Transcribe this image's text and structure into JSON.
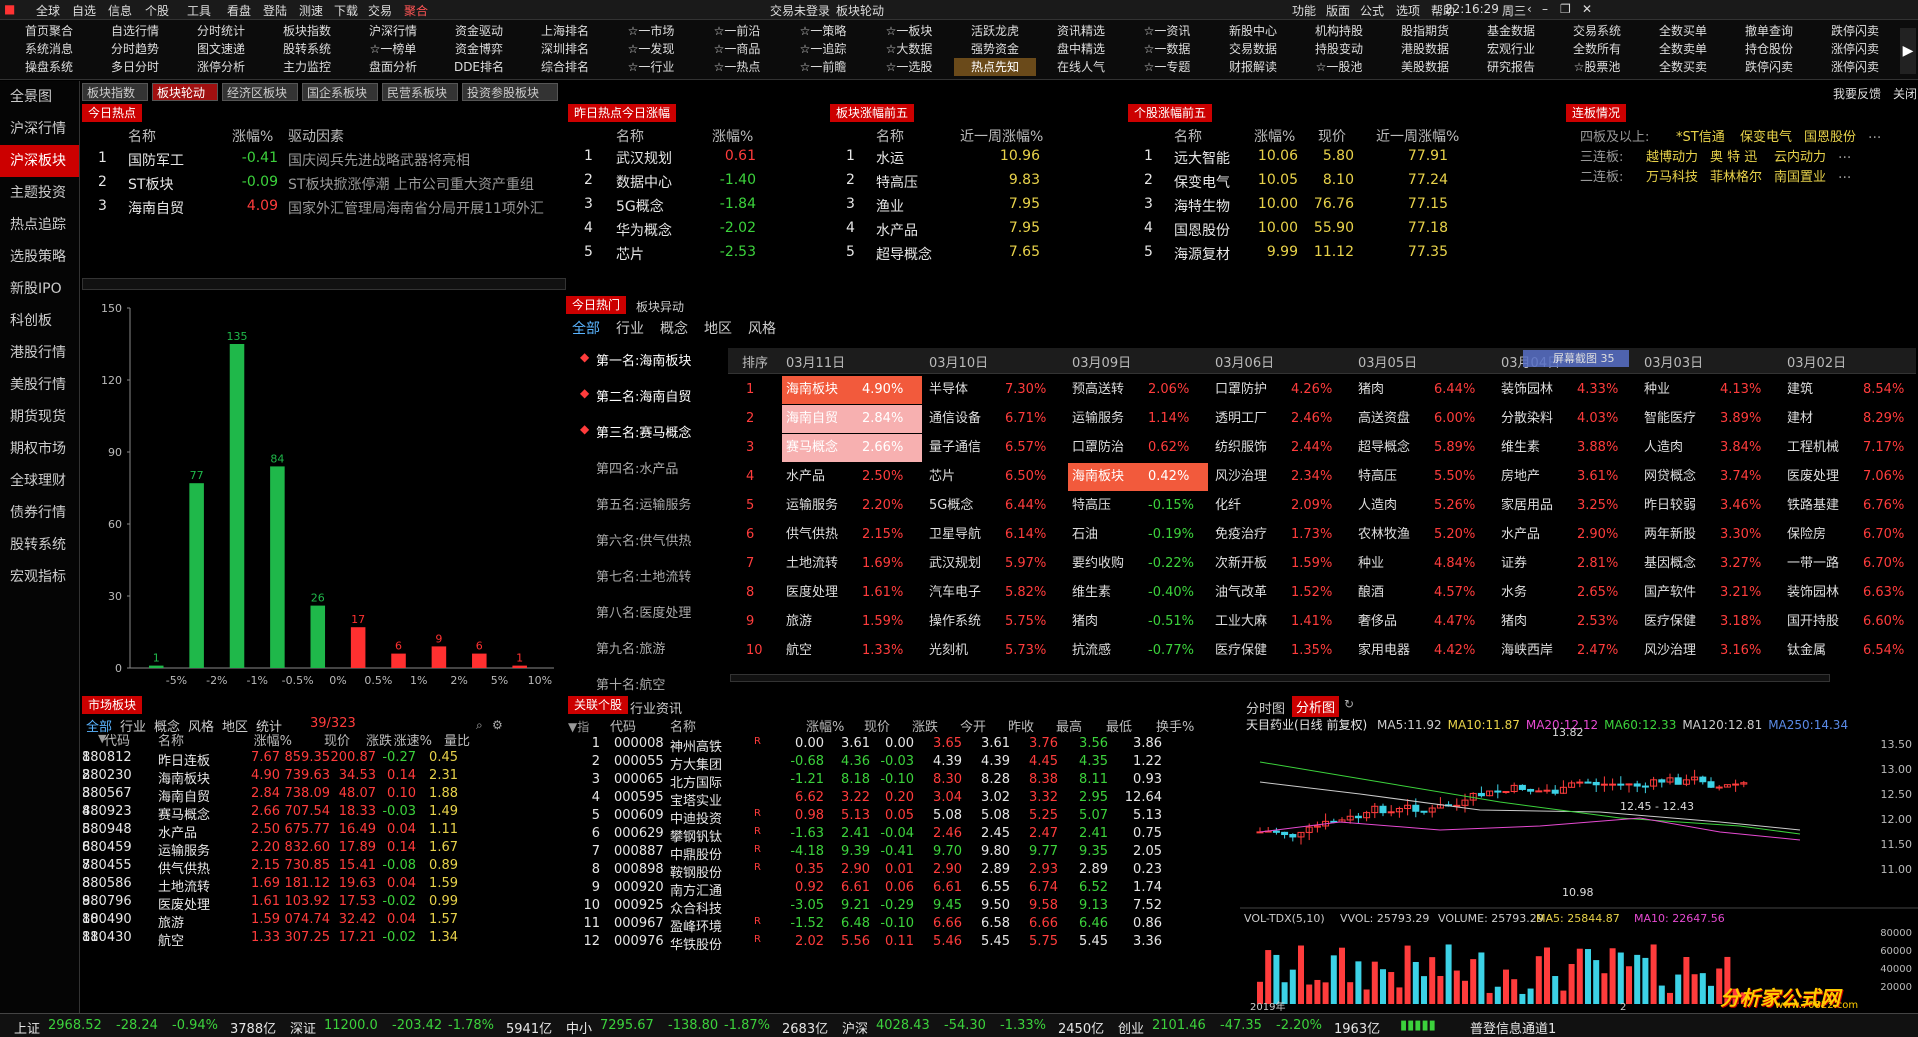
{
  "menu": [
    "全球",
    "自选",
    "信息",
    "个股",
    "工具",
    "看盘",
    "登陆",
    "测速",
    "下载",
    "交易",
    "聚合"
  ],
  "menu_status": [
    "交易未登录",
    "板块轮动"
  ],
  "menu_right": [
    "功能",
    "版面",
    "公式",
    "选项",
    "帮助"
  ],
  "clock": "22:16:29",
  "weekday": "周三",
  "toolbar": [
    [
      "首页聚合",
      "系统消息",
      "操盘系统"
    ],
    [
      "自选行情",
      "分时趋势",
      "多日分时"
    ],
    [
      "分时统计",
      "图文速递",
      "涨停分析"
    ],
    [
      "板块指数",
      "股转系统",
      "主力监控"
    ],
    [
      "沪深行情",
      "☆一榜单",
      "盘面分析"
    ],
    [
      "资金驱动",
      "资金博弈",
      "DDE排名"
    ],
    [
      "上海排名",
      "深圳排名",
      "综合排名"
    ],
    [
      "☆一市场",
      "☆一发现",
      "☆一行业"
    ],
    [
      "☆一前沿",
      "☆一商品",
      "☆一热点"
    ],
    [
      "☆一策略",
      "☆一追踪",
      "☆一前瞻"
    ],
    [
      "☆一板块",
      "☆大数据",
      "☆一选股"
    ],
    [
      "活跃龙虎",
      "强势资金",
      "热点先知"
    ],
    [
      "资讯精选",
      "盘中精选",
      "在线人气"
    ],
    [
      "☆一资讯",
      "☆一数据",
      "☆一专题"
    ],
    [
      "新股中心",
      "交易数据",
      "财报解读"
    ],
    [
      "机构持股",
      "持股变动",
      "☆一股池"
    ],
    [
      "股指期货",
      "港股数据",
      "美股数据"
    ],
    [
      "基金数据",
      "宏观行业",
      "研究报告"
    ],
    [
      "交易系统",
      "全数所有",
      "☆股票池"
    ],
    [
      "全数买单",
      "全数卖单",
      "全数买卖"
    ],
    [
      "撤单查询",
      "持仓股份",
      "跌停闪卖"
    ],
    [
      "跌停闪卖",
      "涨停闪卖",
      "涨停闪卖"
    ]
  ],
  "sidebar": [
    "全景图",
    "沪深行情",
    "沪深板块",
    "主题投资",
    "热点追踪",
    "选股策略",
    "新股IPO",
    "科创板",
    "港股行情",
    "美股行情",
    "期货现货",
    "期权市场",
    "全球理财",
    "债券行情",
    "股转系统",
    "宏观指标"
  ],
  "subtabs": [
    "板块指数",
    "板块轮动",
    "经济区板块",
    "国企系板块",
    "民营系板块",
    "投资参股板块"
  ],
  "top_right": [
    "我要反馈",
    "关闭"
  ],
  "hot_today": {
    "title": "今日热点",
    "headers": [
      "名称",
      "涨幅%",
      "驱动因素"
    ],
    "rows": [
      [
        "1",
        "国防军工",
        "-0.41",
        "国庆阅兵先进战略武器将亮相"
      ],
      [
        "2",
        "ST板块",
        "-0.09",
        "ST板块掀涨停潮 上市公司重大资产重组"
      ],
      [
        "3",
        "海南自贸",
        "4.09",
        "国家外汇管理局海南省分局开展11项外汇"
      ]
    ]
  },
  "yest_hot": {
    "title": "昨日热点今日涨幅",
    "headers": [
      "名称",
      "涨幅%"
    ],
    "rows": [
      [
        "1",
        "武汉规划",
        "0.61"
      ],
      [
        "2",
        "数据中心",
        "-1.40"
      ],
      [
        "3",
        "5G概念",
        "-1.84"
      ],
      [
        "4",
        "华为概念",
        "-2.02"
      ],
      [
        "5",
        "芯片",
        "-2.53"
      ]
    ]
  },
  "sector_top5": {
    "title": "板块涨幅前五",
    "headers": [
      "名称",
      "近一周涨幅%"
    ],
    "rows": [
      [
        "1",
        "水运",
        "10.96"
      ],
      [
        "2",
        "特高压",
        "9.83"
      ],
      [
        "3",
        "渔业",
        "7.95"
      ],
      [
        "4",
        "水产品",
        "7.95"
      ],
      [
        "5",
        "超导概念",
        "7.65"
      ]
    ]
  },
  "stock_top5": {
    "title": "个股涨幅前五",
    "headers": [
      "名称",
      "涨幅%",
      "现价",
      "近一周涨幅%"
    ],
    "rows": [
      [
        "1",
        "远大智能",
        "10.06",
        "5.80",
        "77.91"
      ],
      [
        "2",
        "保变电气",
        "10.05",
        "8.10",
        "77.24"
      ],
      [
        "3",
        "海特生物",
        "10.00",
        "76.76",
        "77.15"
      ],
      [
        "4",
        "国恩股份",
        "10.00",
        "55.90",
        "77.18"
      ],
      [
        "5",
        "海源复材",
        "9.99",
        "11.12",
        "77.35"
      ]
    ]
  },
  "limit_up": {
    "title": "连板情况",
    "rows": [
      {
        "label": "四板及以上:",
        "names": [
          "*ST信通",
          "保变电气",
          "国恩股份"
        ]
      },
      {
        "label": "三连板:",
        "names": [
          "越博动力",
          "奥 特 迅",
          "云内动力"
        ]
      },
      {
        "label": "二连板:",
        "names": [
          "万马科技",
          "菲林格尔",
          "南国置业"
        ]
      }
    ],
    "more": "..."
  },
  "chart_data": {
    "type": "bar",
    "categories": [
      "-5%",
      "-2%",
      "-1%",
      "-0.5%",
      "0%",
      "0.5%",
      "1%",
      "2%",
      "5%",
      "10%"
    ],
    "values": [
      1,
      77,
      135,
      84,
      26,
      17,
      6,
      9,
      6,
      1
    ],
    "ylim": [
      0,
      150
    ],
    "yticks": [
      0,
      30,
      60,
      90,
      120,
      150
    ],
    "colors": {
      "neg": "#1fb84a",
      "pos": "#ff3030"
    }
  },
  "hot_panel": {
    "tabs": [
      "今日热门",
      "板块异动"
    ],
    "filters": [
      "全部",
      "行业",
      "概念",
      "地区",
      "风格"
    ],
    "rank_list": [
      "第一名:海南板块",
      "第二名:海南自贸",
      "第三名:赛马概念",
      "第四名:水产品",
      "第五名:运输服务",
      "第六名:供气供热",
      "第七名:土地流转",
      "第八名:医度处理",
      "第九名:旅游",
      "第十名:航空"
    ],
    "col_header": "排序",
    "dates": [
      "03月11日",
      "03月10日",
      "03月09日",
      "03月06日",
      "03月05日",
      "03月04日",
      "03月03日",
      "03月02日"
    ],
    "overlay": "屏幕截图",
    "overlay_num": "35"
  },
  "hot_grid": [
    [
      [
        "海南板块",
        "4.90%"
      ],
      [
        "半导体",
        "7.30%"
      ],
      [
        "预高送转",
        "2.06%"
      ],
      [
        "口罩防护",
        "4.26%"
      ],
      [
        "猪肉",
        "6.44%"
      ],
      [
        "装饰园林",
        "4.33%"
      ],
      [
        "种业",
        "4.13%"
      ],
      [
        "建筑",
        "8.54%"
      ]
    ],
    [
      [
        "海南自贸",
        "2.84%"
      ],
      [
        "通信设备",
        "6.71%"
      ],
      [
        "运输服务",
        "1.14%"
      ],
      [
        "透明工厂",
        "2.46%"
      ],
      [
        "高送资盘",
        "6.00%"
      ],
      [
        "分散染料",
        "4.03%"
      ],
      [
        "智能医疗",
        "3.89%"
      ],
      [
        "建材",
        "8.29%"
      ]
    ],
    [
      [
        "赛马概念",
        "2.66%"
      ],
      [
        "量子通信",
        "6.57%"
      ],
      [
        "口罩防治",
        "0.62%"
      ],
      [
        "纺织服饰",
        "2.44%"
      ],
      [
        "超导概念",
        "5.89%"
      ],
      [
        "维生素",
        "3.88%"
      ],
      [
        "人造肉",
        "3.84%"
      ],
      [
        "工程机械",
        "7.17%"
      ]
    ],
    [
      [
        "水产品",
        "2.50%"
      ],
      [
        "芯片",
        "6.50%"
      ],
      [
        "海南板块",
        "0.42%"
      ],
      [
        "风沙治理",
        "2.34%"
      ],
      [
        "特高压",
        "5.50%"
      ],
      [
        "房地产",
        "3.61%"
      ],
      [
        "网贷概念",
        "3.74%"
      ],
      [
        "医废处理",
        "7.06%"
      ]
    ],
    [
      [
        "运输服务",
        "2.20%"
      ],
      [
        "5G概念",
        "6.44%"
      ],
      [
        "特高压",
        "-0.15%"
      ],
      [
        "化纤",
        "2.09%"
      ],
      [
        "人造肉",
        "5.26%"
      ],
      [
        "家居用品",
        "3.25%"
      ],
      [
        "昨日较弱",
        "3.46%"
      ],
      [
        "铁路基建",
        "6.76%"
      ]
    ],
    [
      [
        "供气供热",
        "2.15%"
      ],
      [
        "卫星导航",
        "6.14%"
      ],
      [
        "石油",
        "-0.19%"
      ],
      [
        "免疫治疗",
        "1.73%"
      ],
      [
        "农林牧渔",
        "5.20%"
      ],
      [
        "水产品",
        "2.90%"
      ],
      [
        "两年新股",
        "3.30%"
      ],
      [
        "保险房",
        "6.70%"
      ]
    ],
    [
      [
        "土地流转",
        "1.69%"
      ],
      [
        "武汉规划",
        "5.97%"
      ],
      [
        "要约收购",
        "-0.22%"
      ],
      [
        "次新开板",
        "1.59%"
      ],
      [
        "种业",
        "4.84%"
      ],
      [
        "证券",
        "2.81%"
      ],
      [
        "基因概念",
        "3.27%"
      ],
      [
        "一带一路",
        "6.70%"
      ]
    ],
    [
      [
        "医度处理",
        "1.61%"
      ],
      [
        "汽车电子",
        "5.82%"
      ],
      [
        "维生素",
        "-0.40%"
      ],
      [
        "油气改革",
        "1.52%"
      ],
      [
        "酿酒",
        "4.57%"
      ],
      [
        "水务",
        "2.65%"
      ],
      [
        "国产软件",
        "3.21%"
      ],
      [
        "装饰园林",
        "6.63%"
      ]
    ],
    [
      [
        "旅游",
        "1.59%"
      ],
      [
        "操作系统",
        "5.75%"
      ],
      [
        "猪肉",
        "-0.51%"
      ],
      [
        "工业大麻",
        "1.41%"
      ],
      [
        "奢侈品",
        "4.47%"
      ],
      [
        "猪肉",
        "2.53%"
      ],
      [
        "医疗保健",
        "3.18%"
      ],
      [
        "国开持股",
        "6.60%"
      ]
    ],
    [
      [
        "航空",
        "1.33%"
      ],
      [
        "光刻机",
        "5.73%"
      ],
      [
        "抗流感",
        "-0.77%"
      ],
      [
        "医疗保健",
        "1.35%"
      ],
      [
        "家用电器",
        "4.42%"
      ],
      [
        "海峡西岸",
        "2.47%"
      ],
      [
        "风沙治理",
        "3.16%"
      ],
      [
        "钛金属",
        "6.54%"
      ]
    ]
  ],
  "market_sectors": {
    "title": "市场板块",
    "filters": [
      "全部",
      "行业",
      "概念",
      "风格",
      "地区",
      "统计"
    ],
    "count": "39/323",
    "headers": [
      "代码",
      "名称",
      "涨幅%",
      "现价",
      "涨跌",
      "涨速%",
      "量比"
    ],
    "rows": [
      [
        "1",
        "880812",
        "昨日连板",
        "7.67",
        "859.35",
        "200.87",
        "-0.27",
        "0.45"
      ],
      [
        "2",
        "880230",
        "海南板块",
        "4.90",
        "739.63",
        "34.53",
        "0.14",
        "2.31"
      ],
      [
        "3",
        "880567",
        "海南自贸",
        "2.84",
        "738.09",
        "48.07",
        "0.10",
        "1.88"
      ],
      [
        "4",
        "880923",
        "赛马概念",
        "2.66",
        "707.54",
        "18.33",
        "-0.03",
        "1.49"
      ],
      [
        "5",
        "880948",
        "水产品",
        "2.50",
        "675.77",
        "16.49",
        "0.04",
        "1.11"
      ],
      [
        "6",
        "880459",
        "运输服务",
        "2.20",
        "832.60",
        "17.89",
        "0.14",
        "1.67"
      ],
      [
        "7",
        "880455",
        "供气供热",
        "2.15",
        "730.85",
        "15.41",
        "-0.08",
        "0.89"
      ],
      [
        "8",
        "880586",
        "土地流转",
        "1.69",
        "181.12",
        "19.63",
        "0.04",
        "1.59"
      ],
      [
        "9",
        "880796",
        "医废处理",
        "1.61",
        "103.92",
        "17.53",
        "-0.02",
        "0.99"
      ],
      [
        "10",
        "880490",
        "旅游",
        "1.59",
        "074.74",
        "32.42",
        "0.04",
        "1.57"
      ],
      [
        "11",
        "880430",
        "航空",
        "1.33",
        "307.25",
        "17.21",
        "-0.02",
        "1.34"
      ]
    ]
  },
  "related_stocks": {
    "title": "关联个股",
    "tab2": "行业资讯",
    "headers": [
      "代码",
      "名称",
      "涨幅%",
      "现价",
      "涨跌",
      "今开",
      "昨收",
      "最高",
      "最低",
      "换手%"
    ],
    "rows": [
      [
        "1",
        "000008",
        "神州高铁",
        "R",
        "0.00",
        "3.61",
        "0.00",
        "3.65",
        "3.61",
        "3.76",
        "3.56",
        "3.86"
      ],
      [
        "2",
        "000055",
        "方大集团",
        "",
        "-0.68",
        "4.36",
        "-0.03",
        "4.39",
        "4.39",
        "4.45",
        "4.35",
        "1.22"
      ],
      [
        "3",
        "000065",
        "北方国际",
        "",
        "-1.21",
        "8.18",
        "-0.10",
        "8.30",
        "8.28",
        "8.38",
        "8.11",
        "0.93"
      ],
      [
        "4",
        "000595",
        "宝塔实业",
        "",
        "6.62",
        "3.22",
        "0.20",
        "3.04",
        "3.02",
        "3.32",
        "2.95",
        "12.64"
      ],
      [
        "5",
        "000609",
        "中迪投资",
        "R",
        "0.98",
        "5.13",
        "0.05",
        "5.08",
        "5.08",
        "5.25",
        "5.07",
        "5.13"
      ],
      [
        "6",
        "000629",
        "攀钢钒钛",
        "R",
        "-1.63",
        "2.41",
        "-0.04",
        "2.46",
        "2.45",
        "2.47",
        "2.41",
        "0.75"
      ],
      [
        "7",
        "000887",
        "中鼎股份",
        "R",
        "-4.18",
        "9.39",
        "-0.41",
        "9.70",
        "9.80",
        "9.77",
        "9.35",
        "2.05"
      ],
      [
        "8",
        "000898",
        "鞍钢股份",
        "R",
        "0.35",
        "2.90",
        "0.01",
        "2.90",
        "2.89",
        "2.93",
        "2.89",
        "0.23"
      ],
      [
        "9",
        "000920",
        "南方汇通",
        "",
        "0.92",
        "6.61",
        "0.06",
        "6.61",
        "6.55",
        "6.74",
        "6.52",
        "1.74"
      ],
      [
        "10",
        "000925",
        "众合科技",
        "",
        "-3.05",
        "9.21",
        "-0.29",
        "9.45",
        "9.50",
        "9.58",
        "9.13",
        "7.52"
      ],
      [
        "11",
        "000967",
        "盈峰环境",
        "R",
        "-1.52",
        "6.48",
        "-0.10",
        "6.66",
        "6.58",
        "6.66",
        "6.46",
        "0.86"
      ],
      [
        "12",
        "000976",
        "华铁股份",
        "R",
        "2.02",
        "5.56",
        "0.11",
        "5.46",
        "5.45",
        "5.75",
        "5.45",
        "3.36"
      ]
    ]
  },
  "kline": {
    "tabs": [
      "分时图",
      "分析图"
    ],
    "title": "天目药业(日线 前复权)",
    "ma": [
      [
        "MA5:",
        "11.92"
      ],
      [
        "MA10:",
        "11.87"
      ],
      [
        "MA20:",
        "12.12"
      ],
      [
        "MA60:",
        "12.33"
      ],
      [
        "MA120:",
        "12.81"
      ],
      [
        "MA250:",
        "14.34"
      ]
    ],
    "yticks": [
      "13.50",
      "13.00",
      "12.50",
      "12.00",
      "11.50",
      "11.00"
    ],
    "high_label": "13.82",
    "low_label": "10.98",
    "range_label": "12.45 - 12.43",
    "vol_title": "VOL-TDX(5,10)",
    "vol_vals": [
      [
        "VVOL:",
        "25793.29"
      ],
      [
        "VOLUME:",
        "25793.29"
      ],
      [
        "MA5:",
        "25844.87"
      ],
      [
        "MA10:",
        "22647.56"
      ]
    ],
    "vol_ticks": [
      "80000",
      "60000",
      "40000",
      "20000"
    ],
    "x_labels": [
      "2019年",
      "2"
    ]
  },
  "watermark": "分析家公式网",
  "watermark_url": "www.70822.com",
  "status": [
    {
      "name": "上证",
      "v": "2968.52",
      "c": "-28.24",
      "p": "-0.94%",
      "a": "3788亿"
    },
    {
      "name": "深证",
      "v": "11200.0",
      "c": "-203.42",
      "p": "-1.78%",
      "a": "5941亿"
    },
    {
      "name": "中小",
      "v": "7295.67",
      "c": "-138.80",
      "p": "-1.87%",
      "a": "2683亿"
    },
    {
      "name": "沪深",
      "v": "4028.43",
      "c": "-54.30",
      "p": "-1.33%",
      "a": "2450亿"
    },
    {
      "name": "创业",
      "v": "2101.46",
      "c": "-47.35",
      "p": "-2.20%",
      "a": "1963亿"
    }
  ],
  "status_right": "普登信息通道1"
}
